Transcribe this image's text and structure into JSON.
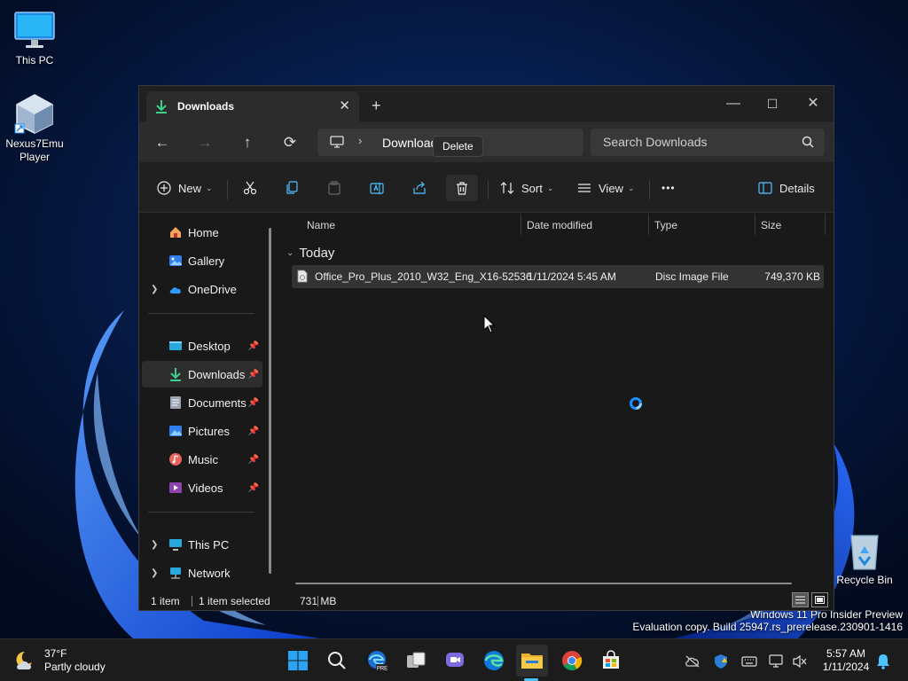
{
  "desktop": {
    "icons": [
      {
        "label": "This PC",
        "icon": "monitor-icon"
      },
      {
        "label": "Nexus7Emu\nPlayer",
        "icon": "virtualbox-icon"
      },
      {
        "label": "Recycle Bin",
        "icon": "recycle-bin-icon"
      }
    ],
    "watermark_line1": "Windows 11 Pro Insider Preview",
    "watermark_line2": "Evaluation copy. Build 25947.rs_prerelease.230901-1416"
  },
  "window": {
    "tab_title": "Downloads",
    "tab_icon": "download-arrow-icon",
    "controls": {
      "minimize": "—",
      "maximize": "☐",
      "close": "✕"
    },
    "nav": {
      "back": "←",
      "forward": "→",
      "up": "↑",
      "refresh": "⟳"
    },
    "address_crumb": "Downloads",
    "search_placeholder": "Search Downloads",
    "tooltip": "Delete",
    "commands": {
      "new_label": "New",
      "sort_label": "Sort",
      "view_label": "View",
      "more_label": "•••",
      "details_label": "Details"
    },
    "sidebar": {
      "home": "Home",
      "gallery": "Gallery",
      "onedrive": "OneDrive",
      "desktop": "Desktop",
      "downloads": "Downloads",
      "documents": "Documents",
      "pictures": "Pictures",
      "music": "Music",
      "videos": "Videos",
      "this_pc": "This PC",
      "network": "Network"
    },
    "columns": {
      "name": "Name",
      "date": "Date modified",
      "type": "Type",
      "size": "Size"
    },
    "group": "Today",
    "files": [
      {
        "name": "Office_Pro_Plus_2010_W32_Eng_X16-52536",
        "date": "1/11/2024 5:45 AM",
        "type": "Disc Image File",
        "size": "749,370 KB"
      }
    ],
    "status": {
      "count": "1 item",
      "selected": "1 item selected",
      "size": "731 MB"
    }
  },
  "taskbar": {
    "weather_temp": "37°F",
    "weather_desc": "Partly cloudy",
    "clock_time": "5:57 AM",
    "clock_date": "1/11/2024"
  },
  "colors": {
    "accent": "#4cc2ff",
    "window_bg": "#191919",
    "selection": "#333333"
  }
}
